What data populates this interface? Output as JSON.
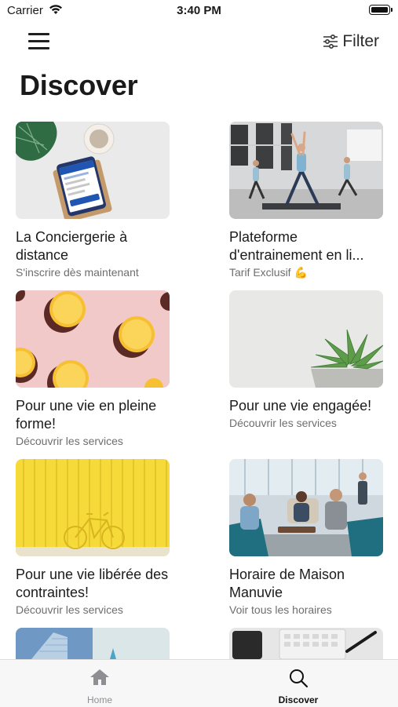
{
  "status_bar": {
    "carrier": "Carrier",
    "time": "3:40 PM"
  },
  "header": {
    "filter_label": "Filter",
    "title": "Discover"
  },
  "cards": [
    {
      "title": "La Conciergerie à distance",
      "subtitle": "S'inscrire dès maintenant"
    },
    {
      "title": "Plateforme d'entrainement en li...",
      "subtitle": "Tarif Exclusif 💪"
    },
    {
      "title": "Pour une vie en pleine forme!",
      "subtitle": "Découvrir les services"
    },
    {
      "title": "Pour une vie engagée!",
      "subtitle": "Découvrir les services"
    },
    {
      "title": "Pour une vie libérée des contraintes!",
      "subtitle": "Découvrir les services"
    },
    {
      "title": "Horaire de Maison Manuvie",
      "subtitle": "Voir tous les horaires"
    }
  ],
  "tab_bar": {
    "home": {
      "label": "Home",
      "icon": "house-icon"
    },
    "discover": {
      "label": "Discover",
      "icon": "search-icon"
    }
  },
  "colors": {
    "active_tab": "#111111",
    "inactive_tab": "#8e8e93",
    "lemon_bg": "#f1c9c8",
    "yellow_wall": "#f6da3a"
  }
}
